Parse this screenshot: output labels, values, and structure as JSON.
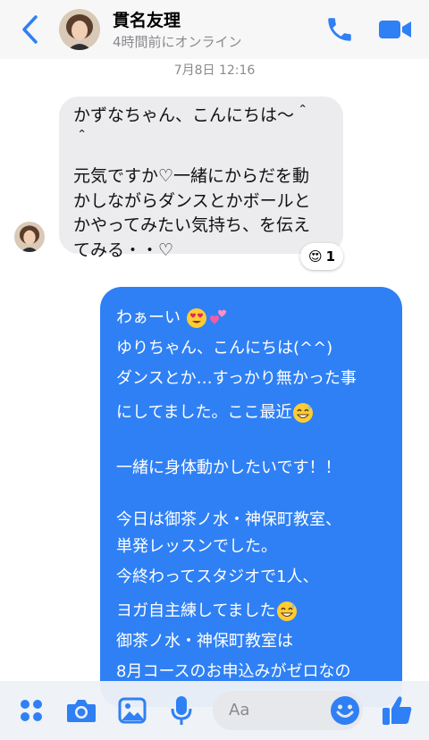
{
  "header": {
    "contact_name": "貫名友理",
    "status": "4時間前にオンライン",
    "back_icon": "chevron-left-icon",
    "call_icon": "phone-icon",
    "video_icon": "video-camera-icon",
    "accent_color": "#2f80f4"
  },
  "chat": {
    "timestamp": "7月8日 12:16",
    "incoming": {
      "line1": "かずなちゃん、こんにちは〜＾",
      "line2": "＾",
      "line3": "元気ですか♡一緒にからだを動",
      "line4": "かしながらダンスとかボールと",
      "line5": "かやってみたい気持ち、を伝え",
      "line6": "てみる・・♡",
      "reaction_emoji": "😍",
      "reaction_count": "1"
    },
    "outgoing": {
      "l1": "わぁーい",
      "l2": "ゆりちゃん、こんにちは(^^)",
      "l3": "ダンスとか…すっかり無かった事",
      "l4": "にしてました。ここ最近",
      "l5": "一緒に身体動かしたいです！！",
      "l6": "今日は御茶ノ水・神保町教室、",
      "l7": "単発レッスンでした。",
      "l8": "今終わってスタジオで1人、",
      "l9": "ヨガ自主練してました",
      "l10": "御茶ノ水・神保町教室は",
      "l11": "8月コースのお申込みがゼロなの"
    }
  },
  "composer": {
    "placeholder": "Aa",
    "icons": [
      "grid-dots-icon",
      "camera-icon",
      "image-icon",
      "microphone-icon",
      "emoji-icon",
      "thumbs-up-icon"
    ]
  }
}
